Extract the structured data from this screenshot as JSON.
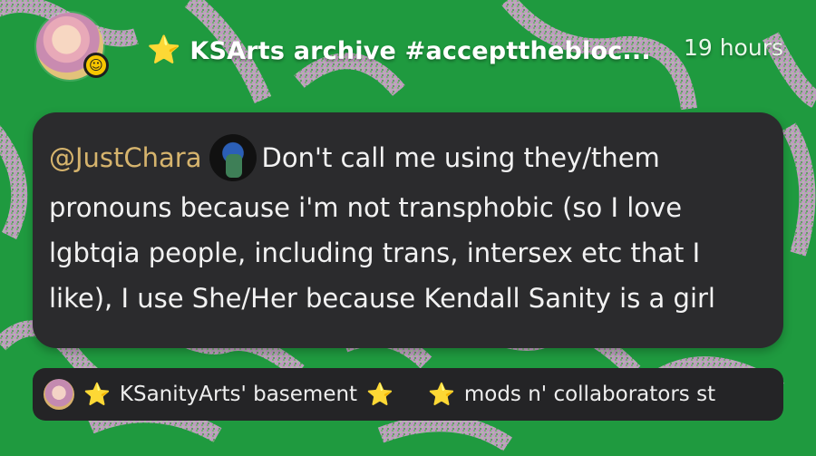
{
  "header": {
    "title": "KSArts archive #accepttheblock",
    "title_display": "KSArts archive #acceptthebloc...",
    "time": "19 hours",
    "star_icon": "⭐"
  },
  "message": {
    "mention": "@JustChara",
    "text": "Don't call me using they/them pronouns because i'm not transphobic (so I love lgbtqia people, including trans, intersex etc that I like), I use She/Her because Kendall Sanity is a girl"
  },
  "chats": [
    {
      "label": "KSanityArts' basement",
      "star_left": "⭐",
      "star_right": "⭐"
    },
    {
      "label": "mods n' collaborators st",
      "star_left": "⭐"
    }
  ],
  "colors": {
    "background": "#1f9a3f",
    "bubble": "#2b2b2d",
    "mention": "#d6b46d",
    "bar": "#242426"
  }
}
